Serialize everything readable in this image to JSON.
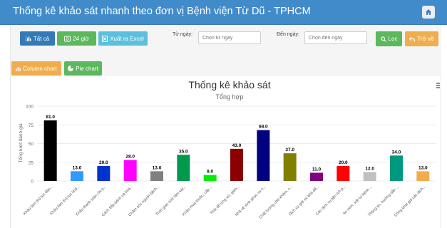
{
  "header": {
    "title": "Thống kê khảo sát nhanh theo đơn vị Bệnh viện Từ Dũ - TPHCM"
  },
  "toolbar": {
    "all_label": "Tất cả",
    "h24_label": "24 giờ",
    "excel_label": "Xuất ra Excel",
    "from_label": "Từ ngày:",
    "from_placeholder": "Chọn từ ngày",
    "to_label": "Đến ngày:",
    "to_placeholder": "Chọn đến ngày",
    "filter_label": "Lọc",
    "back_label": "Trở về",
    "column_chart_label": "Column chart",
    "pie_chart_label": "Pie chart"
  },
  "colors": {
    "header": "#428bca",
    "primary": "#337ab7",
    "success": "#5cb85c",
    "info": "#5bc0de",
    "warning": "#f0ad4e"
  },
  "chart_data": {
    "type": "bar",
    "title": "Thống kê khảo sát",
    "subtitle": "Tổng hợp",
    "ylabel": "Tổng lượt đánh giá",
    "xlabel": "",
    "ylim": [
      0,
      100
    ],
    "yticks": [
      0,
      25,
      50,
      75,
      100
    ],
    "grid": true,
    "categories": [
      "Khâu làm thủ tục đăn...",
      "Khâu làm thủ tục khá...",
      "Khâu thanh toán chi p...",
      "Cách tiếp bệnh và khả...",
      "Chăm sóc người bệnh...",
      "Thời gian chờ lâm sát...",
      "Khâu mua thuốc, cấp ...",
      "Thái độ ứng xử, giao...",
      "Nhà vệ sinh phục vụ n...",
      "Chất lượng chờ khám, c...",
      "Dịch vụ giữ xe khá dễ...",
      "Các dịch vụ tiện ích p...",
      "An ninh, trật tự bệnh ...",
      "Thông tin, hướng dẫn ...",
      "Công khai giá các dịch..."
    ],
    "values": [
      81,
      13,
      20,
      28,
      13,
      35,
      8,
      43,
      68,
      37,
      11,
      20,
      12,
      34,
      13
    ],
    "value_labels": [
      "81.0",
      "13.0",
      "20.0",
      "28.0",
      "13.0",
      "35.0",
      "8.0",
      "43.0",
      "68.0",
      "37.0",
      "11.0",
      "20.0",
      "12.0",
      "34.0",
      "13.0"
    ],
    "colors": [
      "#000000",
      "#3399ff",
      "#0033cc",
      "#ff00ff",
      "#808080",
      "#00994d",
      "#00ee00",
      "#8b0000",
      "#000080",
      "#808000",
      "#800080",
      "#ff0000",
      "#c0c0c0",
      "#009980",
      "#f0ad4e"
    ]
  }
}
